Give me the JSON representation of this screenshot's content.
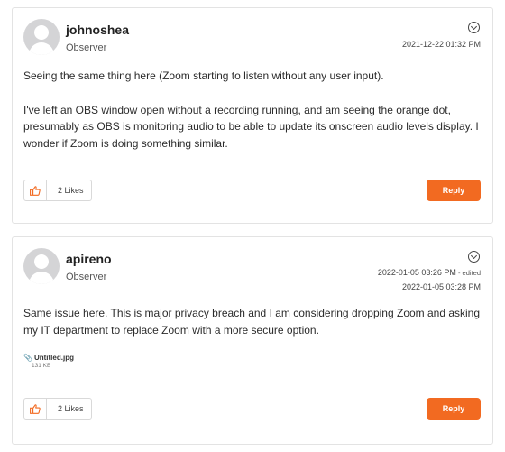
{
  "posts": [
    {
      "username": "johnoshea",
      "role": "Observer",
      "dates": [
        {
          "text": "2021-12-22 01:32 PM",
          "edited": ""
        }
      ],
      "paragraphs": [
        "Seeing the same thing here (Zoom starting to listen without any user input).",
        "I've left an OBS window open without a recording running, and am seeing the orange dot, presumably as OBS is monitoring audio to be able to update its onscreen audio levels display. I wonder if Zoom is doing something similar."
      ],
      "likes": "2 Likes",
      "reply_label": "Reply"
    },
    {
      "username": "apireno",
      "role": "Observer",
      "dates": [
        {
          "text": "2022-01-05 03:26 PM",
          "edited": " - edited"
        },
        {
          "text": "2022-01-05 03:28 PM",
          "edited": ""
        }
      ],
      "paragraphs": [
        "Same issue here. This is major privacy breach and I am considering dropping Zoom and asking my IT department to replace Zoom with a more secure option."
      ],
      "attachment": {
        "name": "Untitled.jpg",
        "size": "131 KB"
      },
      "likes": "2 Likes",
      "reply_label": "Reply"
    }
  ],
  "colors": {
    "accent": "#f26a21",
    "border": "#e3e3e3",
    "avatar_bg": "#d4d4d6"
  },
  "icons": {
    "menu": "chevron-down-circle-icon",
    "like": "thumbs-up-icon",
    "attachment": "paperclip-icon"
  }
}
